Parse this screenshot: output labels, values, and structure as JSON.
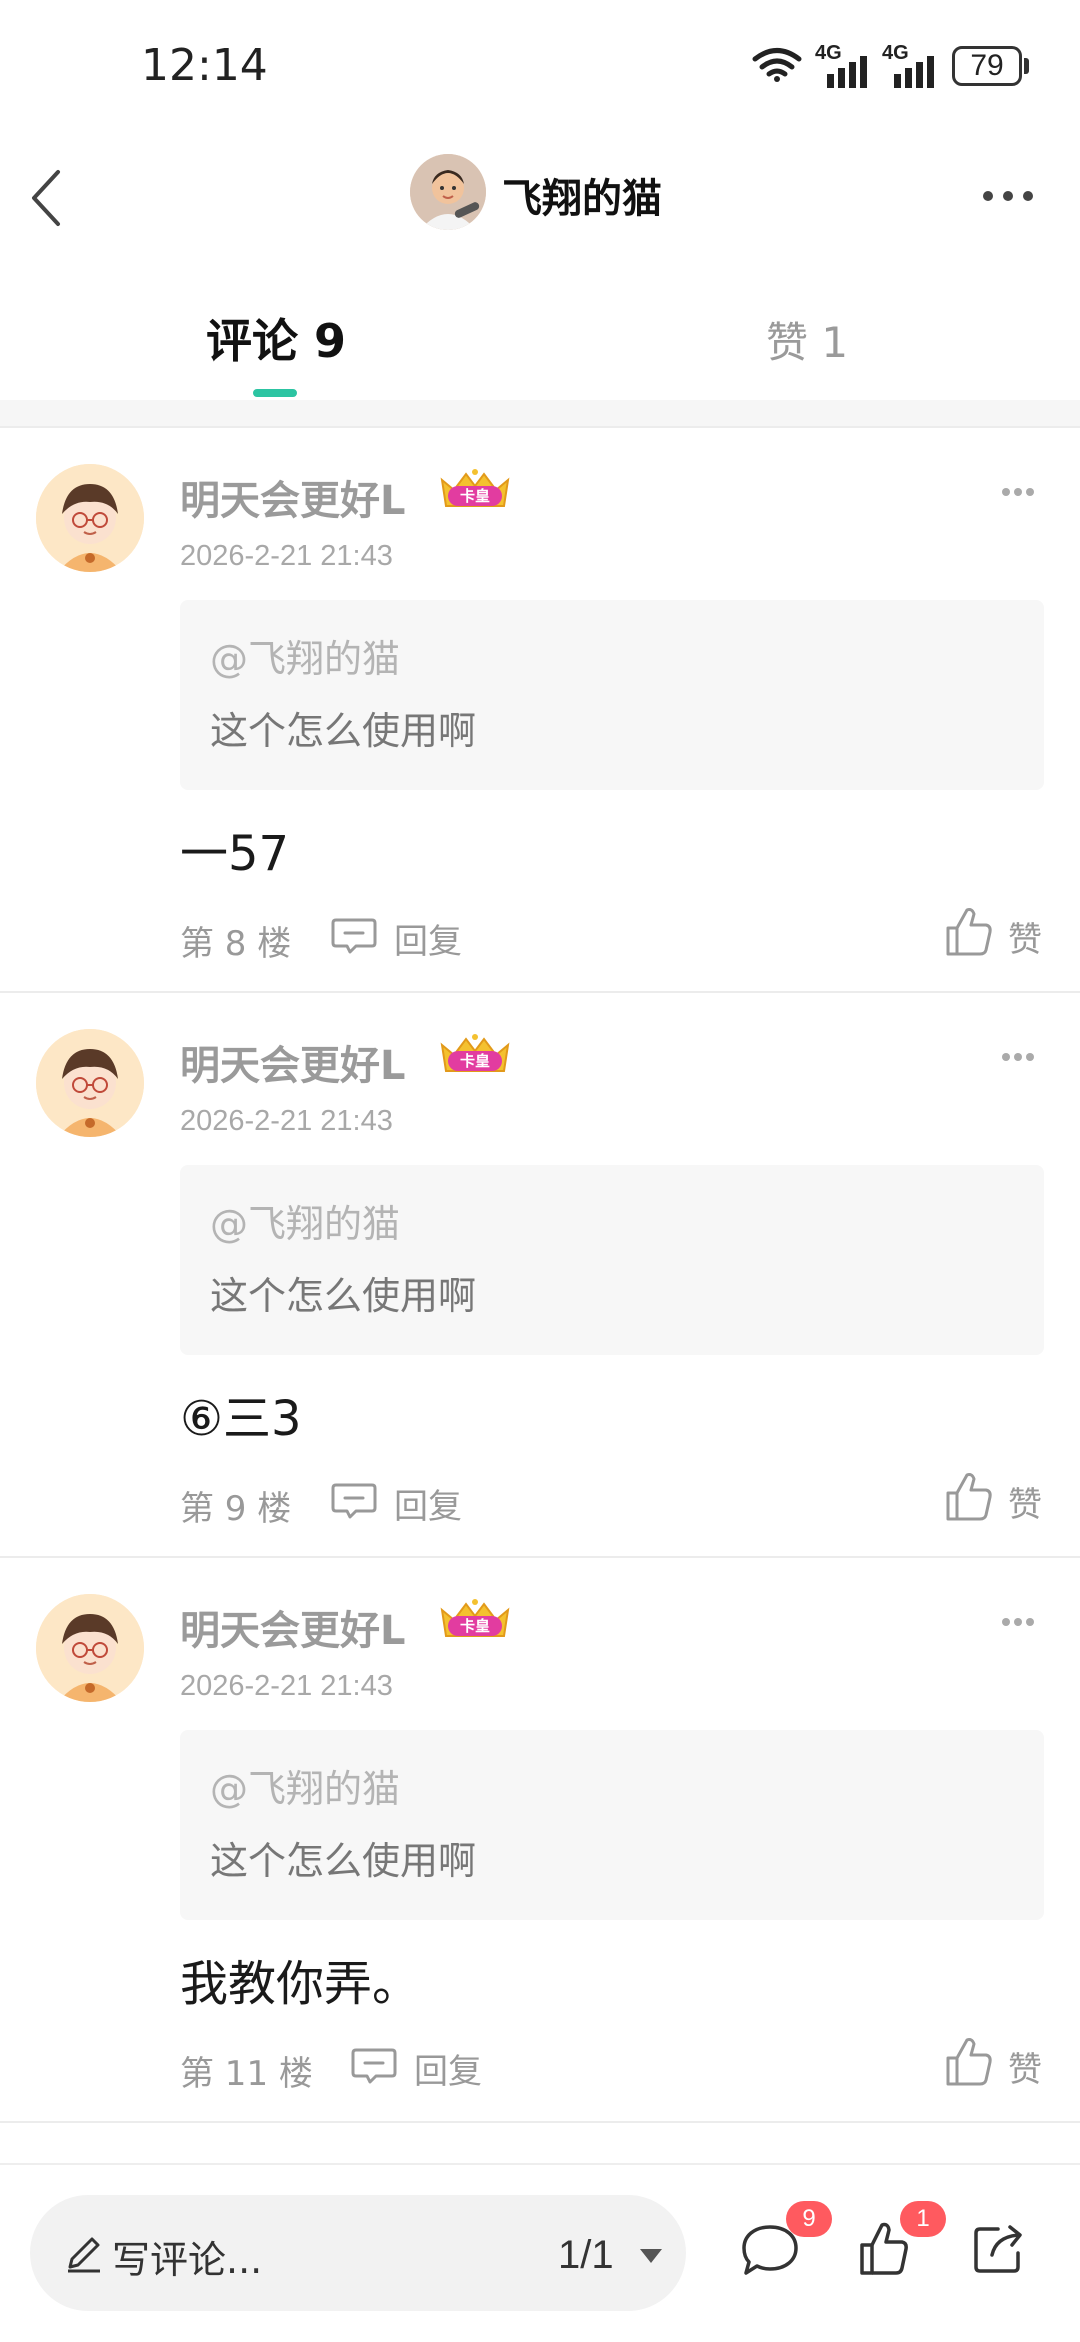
{
  "status_bar": {
    "time": "12:14",
    "network_1": "4G",
    "network_2": "4G",
    "battery": "79"
  },
  "header": {
    "title": "飞翔的猫"
  },
  "tabs": {
    "comments": "评论 9",
    "likes": "赞 1"
  },
  "comments": [
    {
      "username": "明天会更好L",
      "badge": "卡皇",
      "time": "2026-2-21 21:43",
      "quote_at": "@飞翔的猫",
      "quote_text": "这个怎么使用啊",
      "text": "一57",
      "floor": "第 8 楼",
      "reply_label": "回复",
      "like_label": "赞"
    },
    {
      "username": "明天会更好L",
      "badge": "卡皇",
      "time": "2026-2-21 21:43",
      "quote_at": "@飞翔的猫",
      "quote_text": "这个怎么使用啊",
      "text": "⑥三3",
      "floor": "第 9 楼",
      "reply_label": "回复",
      "like_label": "赞"
    },
    {
      "username": "明天会更好L",
      "badge": "卡皇",
      "time": "2026-2-21 21:43",
      "quote_at": "@飞翔的猫",
      "quote_text": "这个怎么使用啊",
      "text": "我教你弄。",
      "floor": "第 11 楼",
      "reply_label": "回复",
      "like_label": "赞"
    }
  ],
  "bottom_bar": {
    "input_placeholder": "写评论...",
    "pager": "1/1",
    "comment_count": "9",
    "like_count": "1"
  },
  "colors": {
    "accent": "#2cc4a2",
    "badge_red": "#ff5a5f",
    "muted": "#999999"
  }
}
